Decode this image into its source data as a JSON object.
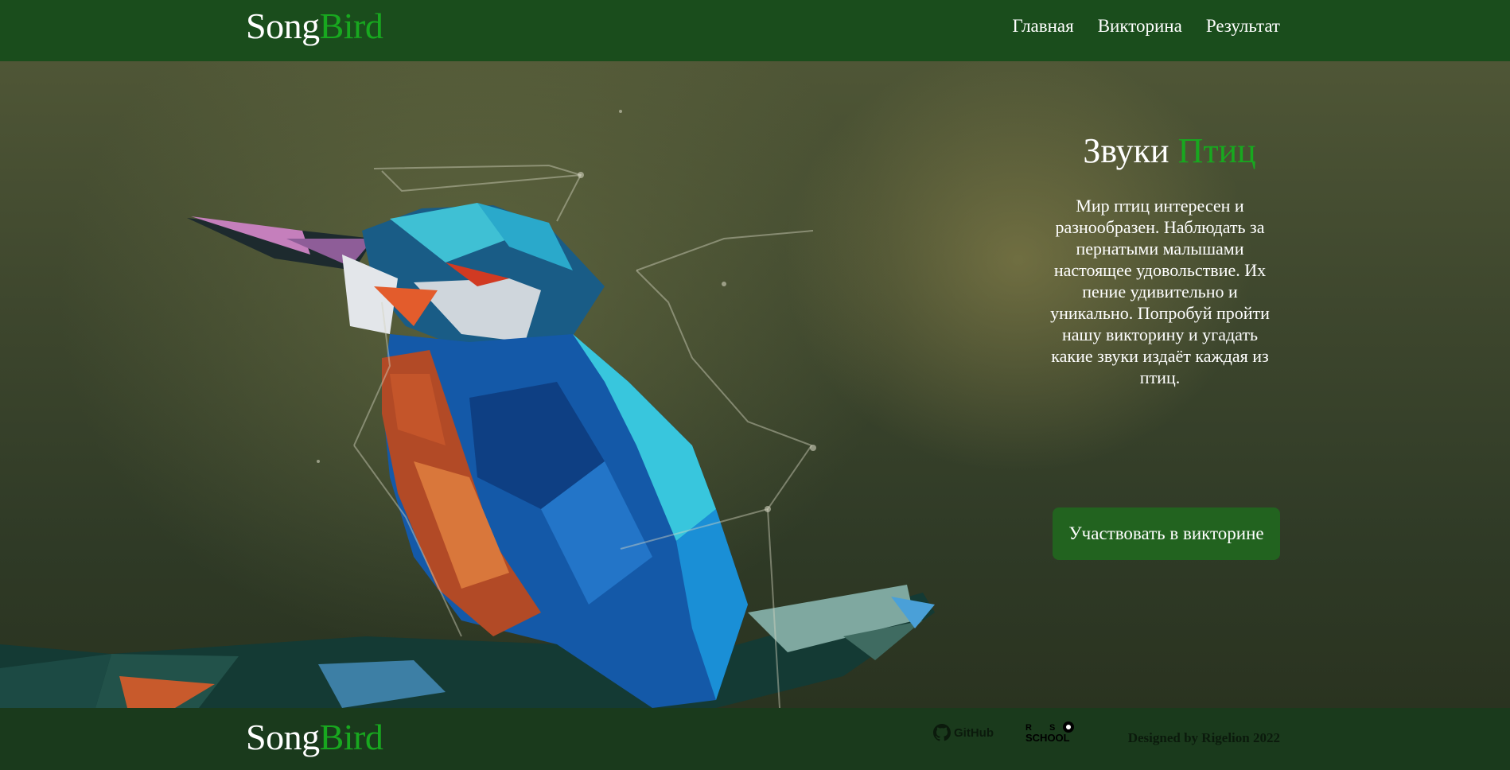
{
  "header": {
    "logo_part1": "Song",
    "logo_part2": "Bird",
    "nav": [
      "Главная",
      "Викторина",
      "Результат"
    ]
  },
  "hero": {
    "title_part1": "Звуки",
    "title_part2": "Птиц",
    "text": "Мир птиц интересен и разнообразен. Наблюдать за пернатыми малышами настоящее удовольствие. Их пение удивительно и уникально. Попробуй пройти нашу викторину и угадать какие звуки издаёт каждая из птиц.",
    "cta_label": "Участвовать в викторине"
  },
  "footer": {
    "logo_part1": "Song",
    "logo_part2": "Bird",
    "github_label": "GitHub",
    "rss_label": "RS SCHOOL",
    "credit": "Designed by Rigelion 2022"
  },
  "colors": {
    "header_bg": "#1a4d1c",
    "accent": "#18a81f",
    "cta_bg": "#22631f",
    "footer_bg": "#1a3a1c"
  }
}
